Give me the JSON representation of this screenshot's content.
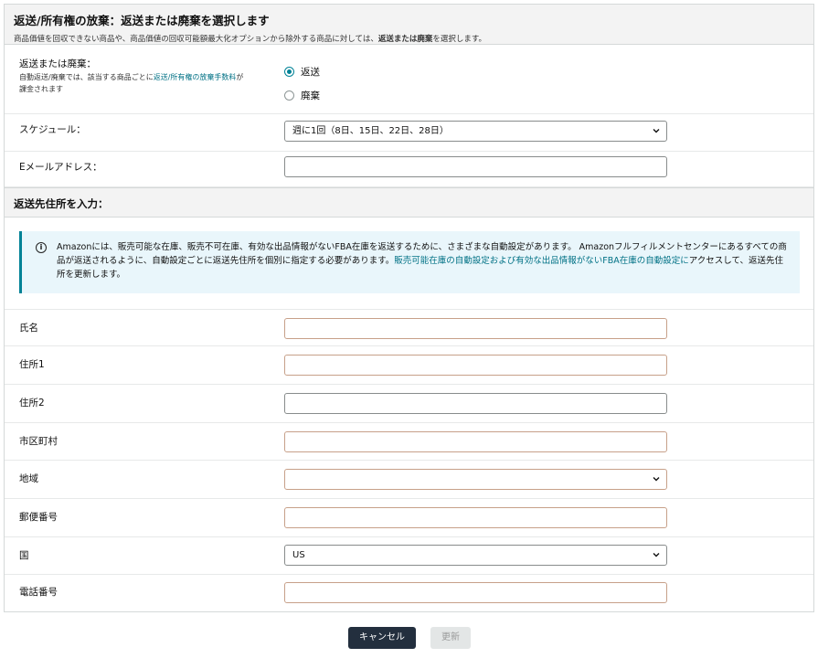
{
  "header": {
    "title": "返送/所有権の放棄：返送または廃棄を選択します",
    "desc_prefix": "商品価値を回収できない商品や、商品価値の回収可能額最大化オプションから除外する商品に対しては、",
    "desc_bold": "返送または廃棄",
    "desc_suffix": "を選択します。"
  },
  "disposal": {
    "label": "返送または廃棄：",
    "note_prefix": "自動返送/廃棄では、該当する商品ごとに",
    "note_link": "返送/所有権の放棄手数料",
    "note_mid": "が",
    "note_suffix": "課金されます",
    "options": [
      {
        "label": "返送",
        "selected": true
      },
      {
        "label": "廃棄",
        "selected": false
      }
    ]
  },
  "schedule": {
    "label": "スケジュール：",
    "value": "週に1回（8日、15日、22日、28日）"
  },
  "email": {
    "label": "Eメールアドレス：",
    "value": ""
  },
  "address_section": {
    "title": "返送先住所を入力："
  },
  "info": {
    "text": "Amazonには、販売可能な在庫、販売不可在庫、有効な出品情報がないFBA在庫を返送するために、さまざまな自動設定があります。 Amazonフルフィルメントセンターにあるすべての商品が返送されるように、自動設定ごとに返送先住所を個別に指定する必要があります。",
    "link": "販売可能在庫の自動設定および有効な出品情報がないFBA在庫の自動設定に",
    "suffix": "アクセスして、返送先住所を更新します。"
  },
  "fields": {
    "name": "氏名",
    "address1": "住所1",
    "address2": "住所2",
    "city": "市区町村",
    "region": "地域",
    "postal": "郵便番号",
    "country": "国",
    "country_value": "US",
    "phone": "電話番号"
  },
  "buttons": {
    "cancel": "キャンセル",
    "update": "更新"
  },
  "colors": {
    "accent": "#008296",
    "link": "#007185",
    "primary_button": "#232f3e",
    "required_border": "#c7a089"
  }
}
